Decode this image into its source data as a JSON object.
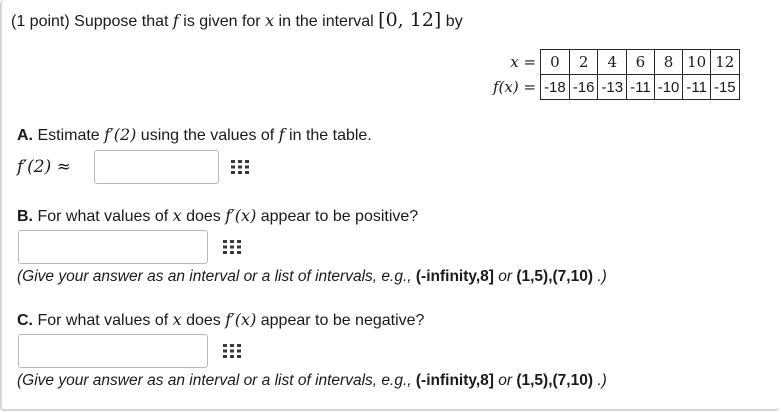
{
  "intro": {
    "prefix": "(1 point) Suppose that ",
    "f": "f",
    "middle": " is given for ",
    "x": "x",
    "middle2": " in the interval ",
    "interval": "[0, 12]",
    "suffix": " by"
  },
  "table": {
    "x_label": "x =",
    "f_label": "f(x) =",
    "x_values": [
      "0",
      "2",
      "4",
      "6",
      "8",
      "10",
      "12"
    ],
    "f_values": [
      "-18",
      "-16",
      "-13",
      "-11",
      "-10",
      "-11",
      "-15"
    ]
  },
  "partA": {
    "letter": "A.",
    "text1": " Estimate ",
    "fprime2": "f′(2)",
    "text2": " using the values of ",
    "f": "f",
    "text3": " in the table.",
    "answer_label": "f′(2) ≈",
    "answer_value": ""
  },
  "partB": {
    "letter": "B.",
    "text1": " For what values of ",
    "x": "x",
    "text2": " does ",
    "fprime": "f′(x)",
    "text3": " appear to be positive?",
    "answer_value": "",
    "hint_prefix": "(Give your answer as an interval or a list of intervals, e.g., ",
    "hint_ex1": "(-infinity,8]",
    "hint_or": " or ",
    "hint_ex2": "(1,5),(7,10)",
    "hint_suffix": " .)"
  },
  "partC": {
    "letter": "C.",
    "text1": " For what values of ",
    "x": "x",
    "text2": " does ",
    "fprime": "f′(x)",
    "text3": " appear to be negative?",
    "answer_value": "",
    "hint_prefix": "(Give your answer as an interval or a list of intervals, e.g., ",
    "hint_ex1": "(-infinity,8]",
    "hint_or": " or ",
    "hint_ex2": "(1,5),(7,10)",
    "hint_suffix": " .)"
  },
  "icons": {
    "equation_editor": "grid-icon"
  }
}
